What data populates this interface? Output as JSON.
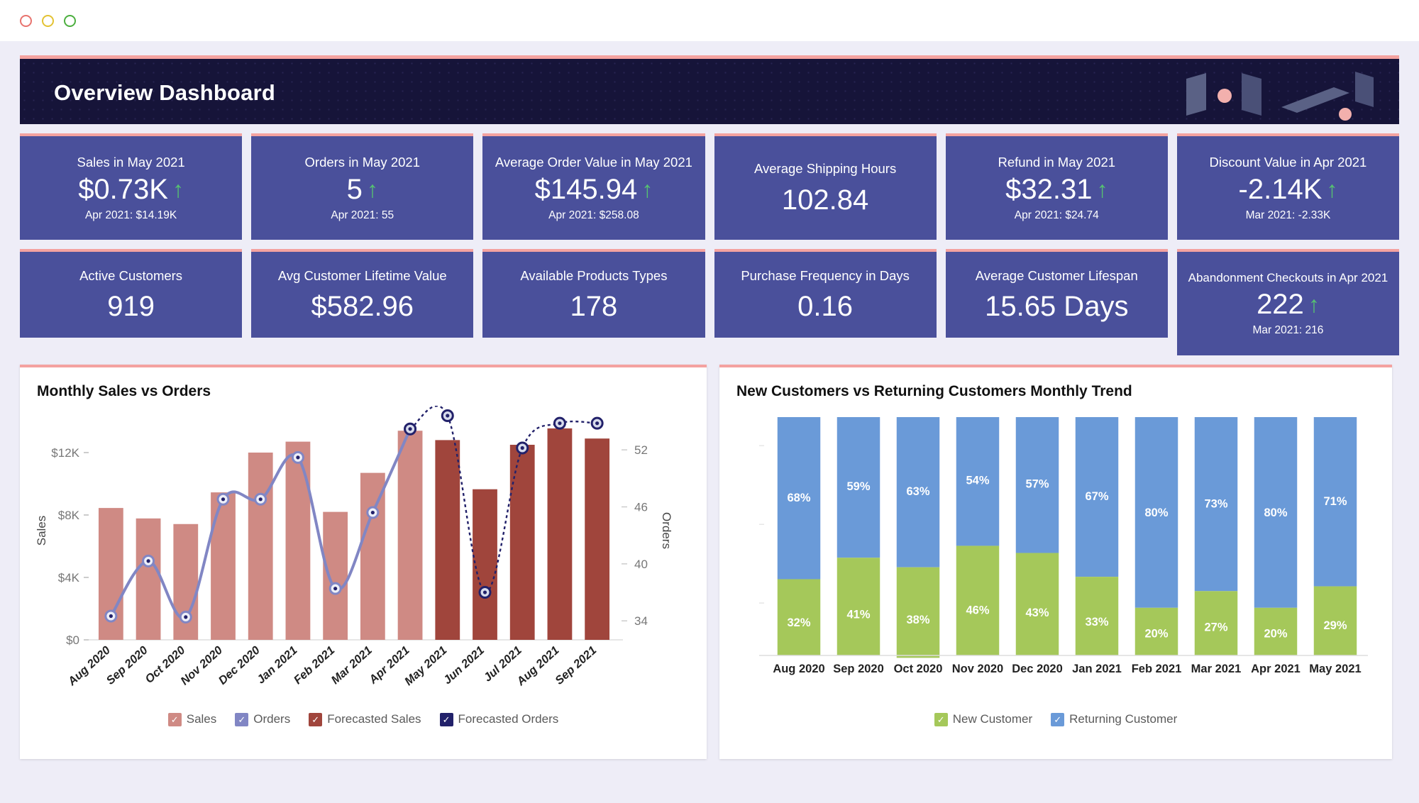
{
  "window": {
    "buttons": [
      "close-dot",
      "minimize-dot",
      "maximize-dot"
    ]
  },
  "header": {
    "title": "Overview Dashboard",
    "accent_color": "#f4a2a0",
    "background_color": "#161439",
    "logo_name": "abstract-parallelogram-logo"
  },
  "kpi_rows": [
    {
      "cards": [
        {
          "title": "Sales in May 2021",
          "value": "$0.73K",
          "arrow": "↑",
          "sub": "Apr 2021: $14.19K"
        },
        {
          "title": "Orders in May 2021",
          "value": "5",
          "arrow": "↑",
          "sub": "Apr 2021: 55"
        },
        {
          "title": "Average Order Value in May 2021",
          "value": "$145.94",
          "arrow": "↑",
          "sub": "Apr 2021: $258.08"
        },
        {
          "title": "Average Shipping Hours",
          "value": "102.84",
          "arrow": "",
          "sub": ""
        },
        {
          "title": "Refund in May 2021",
          "value": "$32.31",
          "arrow": "↑",
          "sub": "Apr 2021: $24.74"
        },
        {
          "title": "Discount Value in Apr 2021",
          "value": "-2.14K",
          "arrow": "↑",
          "sub": "Mar 2021: -2.33K"
        }
      ]
    },
    {
      "cards": [
        {
          "title": "Active Customers",
          "value": "919",
          "arrow": "",
          "sub": ""
        },
        {
          "title": "Avg Customer Lifetime Value",
          "value": "$582.96",
          "arrow": "",
          "sub": ""
        },
        {
          "title": "Available Products Types",
          "value": "178",
          "arrow": "",
          "sub": ""
        },
        {
          "title": "Purchase Frequency in Days",
          "value": "0.16",
          "arrow": "",
          "sub": ""
        },
        {
          "title": "Average Customer Lifespan",
          "value": "15.65 Days",
          "arrow": "",
          "sub": ""
        },
        {
          "title": "Abandonment Checkouts in Apr 2021",
          "value": "222",
          "arrow": "↑",
          "sub": "Mar 2021: 216"
        }
      ]
    }
  ],
  "chart_data": [
    {
      "type": "bar",
      "title": "Monthly Sales vs Orders",
      "xlabel": "",
      "ylabel": "Sales",
      "y2label": "Orders",
      "ylim": [
        0,
        14000
      ],
      "y2lim": [
        32,
        55
      ],
      "yticks": [
        "$0",
        "$4K",
        "$8K",
        "$12K"
      ],
      "ytick_values": [
        0,
        4000,
        8000,
        12000
      ],
      "y2ticks": [
        "34",
        "40",
        "46",
        "52"
      ],
      "y2tick_values": [
        34,
        40,
        46,
        52
      ],
      "grid": false,
      "legend_position": "bottom",
      "categories": [
        "Aug 2020",
        "Sep 2020",
        "Oct 2020",
        "Nov 2020",
        "Dec 2020",
        "Jan 2021",
        "Feb 2021",
        "Mar 2021",
        "Apr 2021",
        "May 2021",
        "Jun 2021",
        "Jul 2021",
        "Aug 2021",
        "Sep 2021"
      ],
      "series": [
        {
          "name": "Sales",
          "color": "#cf8a84",
          "type": "bar",
          "values": [
            8450,
            7780,
            7420,
            9450,
            12000,
            12700,
            8200,
            10700,
            13400,
            null,
            null,
            null,
            null,
            null
          ]
        },
        {
          "name": "Forecasted Sales",
          "color": "#a0453c",
          "type": "bar",
          "values": [
            null,
            null,
            null,
            null,
            null,
            null,
            null,
            null,
            null,
            12800,
            9650,
            12500,
            13550,
            12900
          ]
        },
        {
          "name": "Orders",
          "color": "#8186c4",
          "type": "line",
          "values": [
            34.5,
            40.3,
            34.4,
            46.8,
            46.8,
            51.2,
            37.4,
            45.4,
            54.2,
            null,
            null,
            null,
            null,
            null
          ]
        },
        {
          "name": "Forecasted Orders",
          "color": "#22216a",
          "type": "line-dashed",
          "values": [
            null,
            null,
            null,
            null,
            null,
            null,
            null,
            null,
            54.2,
            55.6,
            37.0,
            52.2,
            54.8,
            54.8
          ]
        }
      ],
      "legend": [
        "Sales",
        "Orders",
        "Forecasted Sales",
        "Forecasted Orders"
      ],
      "legend_colors": [
        "#cf8a84",
        "#8186c4",
        "#a0453c",
        "#22216a"
      ]
    },
    {
      "type": "bar",
      "title": "New Customers vs Returning Customers Monthly Trend",
      "stacked": true,
      "stack_mode": "percent",
      "xlabel": "",
      "ylabel": "",
      "ylim": [
        0,
        100
      ],
      "grid": false,
      "legend_position": "bottom",
      "categories": [
        "Aug 2020",
        "Sep 2020",
        "Oct 2020",
        "Nov 2020",
        "Dec 2020",
        "Jan 2021",
        "Feb 2021",
        "Mar 2021",
        "Apr 2021",
        "May 2021"
      ],
      "series": [
        {
          "name": "New Customer",
          "color": "#a5c85a",
          "values": [
            32,
            41,
            38,
            46,
            43,
            33,
            20,
            27,
            20,
            29
          ],
          "labels": [
            "32%",
            "41%",
            "38%",
            "46%",
            "43%",
            "33%",
            "20%",
            "27%",
            "20%",
            "29%"
          ]
        },
        {
          "name": "Returning Customer",
          "color": "#6a9ad8",
          "values": [
            68,
            59,
            63,
            54,
            57,
            67,
            80,
            73,
            80,
            71
          ],
          "labels": [
            "68%",
            "59%",
            "63%",
            "54%",
            "57%",
            "67%",
            "80%",
            "73%",
            "80%",
            "71%"
          ]
        }
      ],
      "legend": [
        "New Customer",
        "Returning Customer"
      ],
      "legend_colors": [
        "#a5c85a",
        "#6a9ad8"
      ]
    }
  ]
}
